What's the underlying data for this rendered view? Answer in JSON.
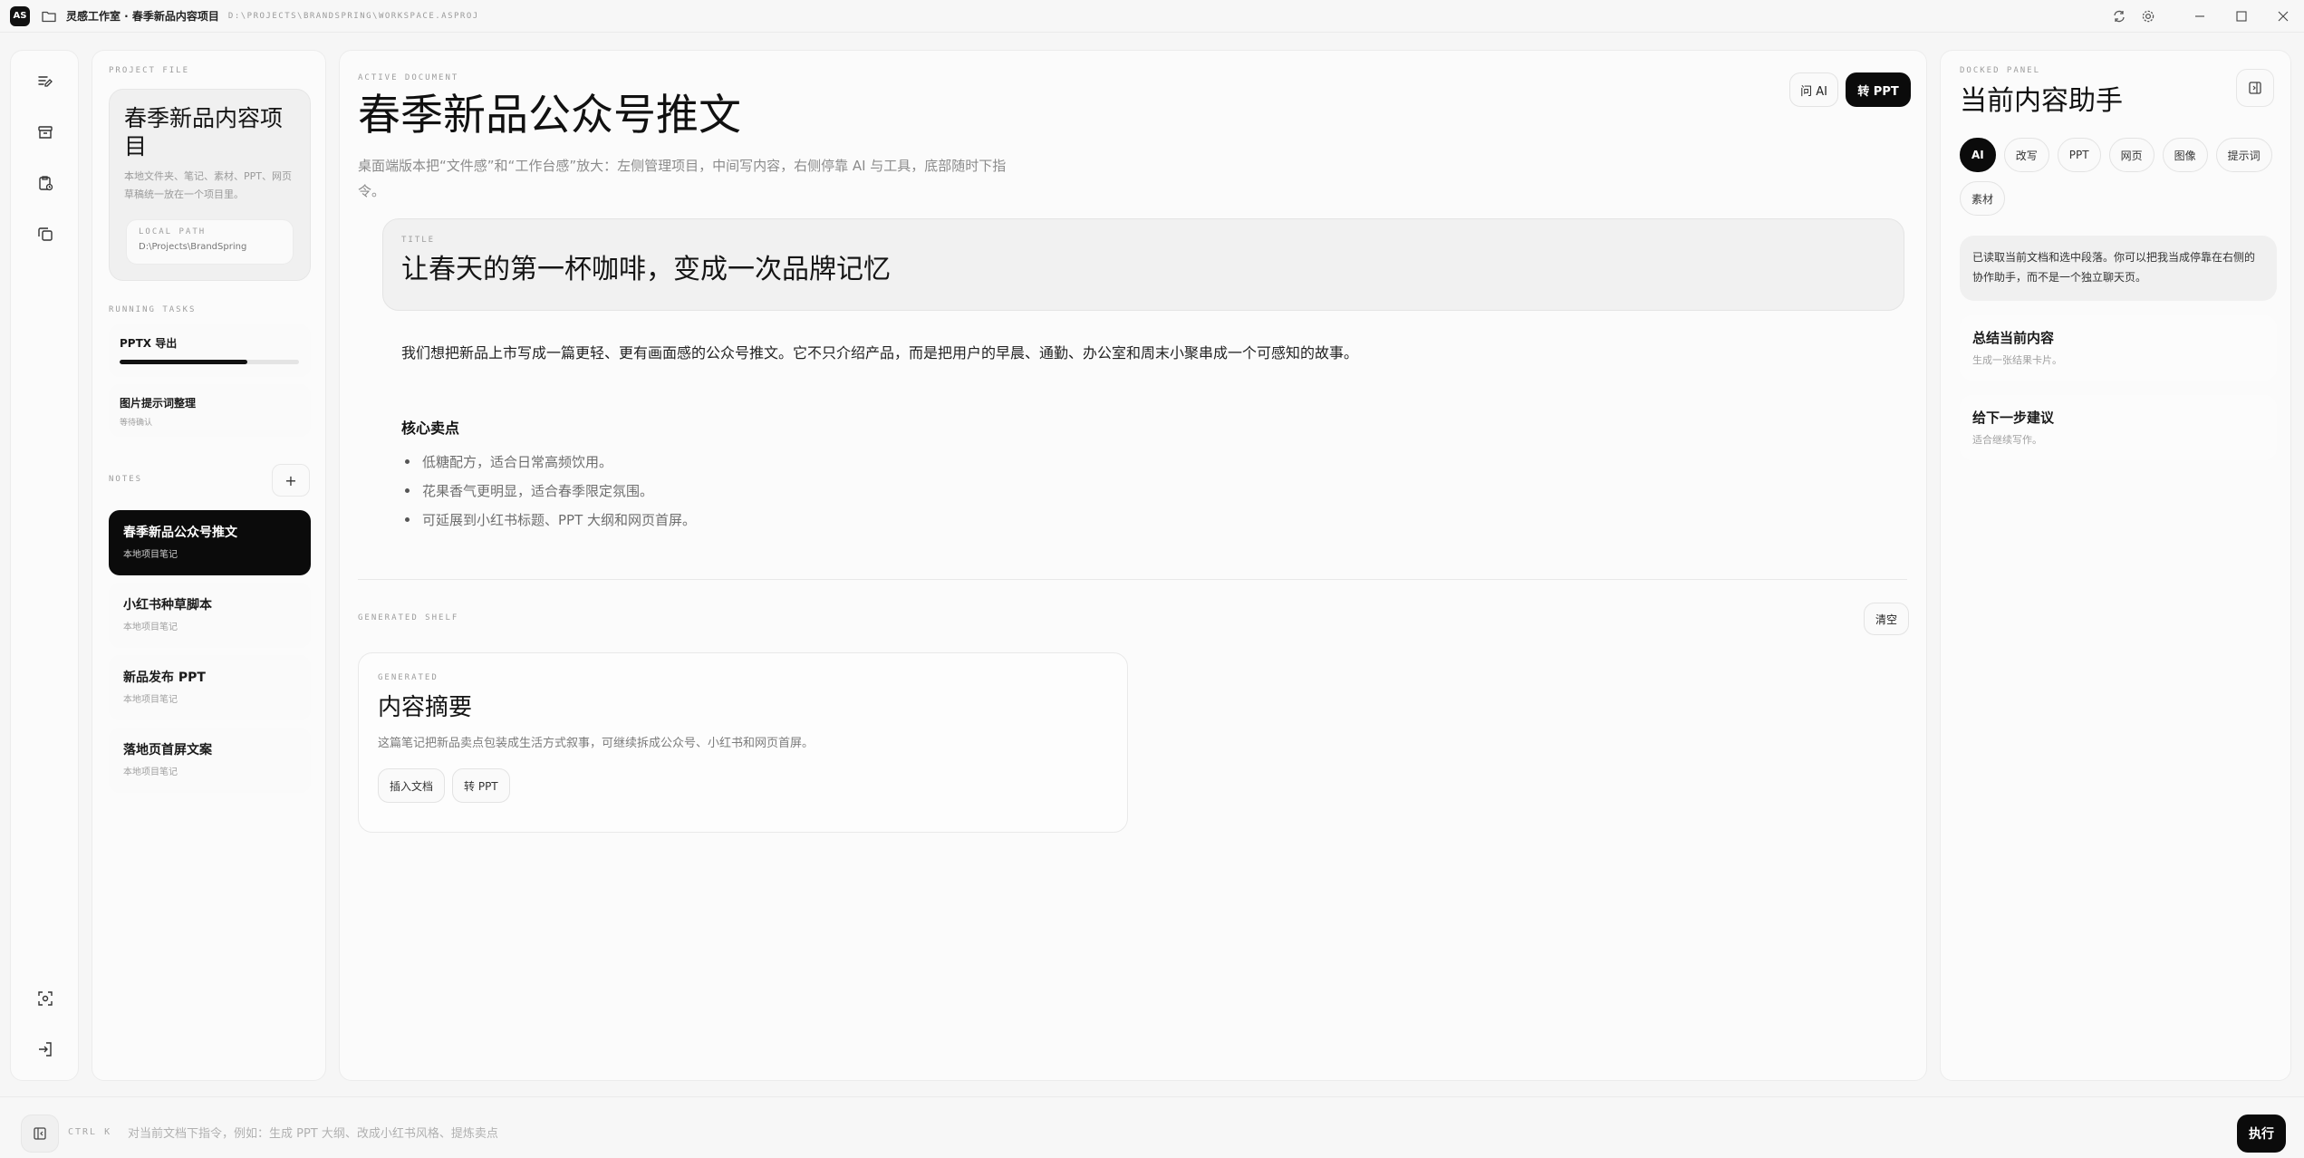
{
  "titlebar": {
    "logo": "AS",
    "title": "灵感工作室 · 春季新品内容项目",
    "path": "D:\\PROJECTS\\BRANDSPRING\\WORKSPACE.ASPROJ",
    "icons": [
      "sync-icon",
      "settings-icon",
      "minimize-icon",
      "maximize-icon",
      "close-icon"
    ]
  },
  "rail": {
    "top_icons": [
      "editor-icon",
      "archive-icon",
      "task-clipboard-icon",
      "copy-icon"
    ],
    "bottom_icons": [
      "capture-icon",
      "exit-icon"
    ]
  },
  "project": {
    "label": "PROJECT FILE",
    "name": "春季新品内容项目",
    "description": "本地文件夹、笔记、素材、PPT、网页草稿统一放在一个项目里。",
    "path_label": "LOCAL PATH",
    "path_value": "D:\\Projects\\BrandSpring",
    "tasks_label": "RUNNING TASKS",
    "tasks": [
      {
        "name": "PPTX 导出",
        "progress": 0.71
      },
      {
        "name": "图片提示词整理",
        "status": "等待确认"
      }
    ],
    "notes_label": "NOTES",
    "add_note": "+",
    "notes": [
      {
        "title": "春季新品公众号推文",
        "sub": "本地项目笔记",
        "active": true
      },
      {
        "title": "小红书种草脚本",
        "sub": "本地项目笔记"
      },
      {
        "title": "新品发布 PPT",
        "sub": "本地项目笔记"
      },
      {
        "title": "落地页首屏文案",
        "sub": "本地项目笔记"
      }
    ]
  },
  "document": {
    "label": "ACTIVE DOCUMENT",
    "title": "春季新品公众号推文",
    "description": "桌面端版本把“文件感”和“工作台感”放大：左侧管理项目，中间写内容，右侧停靠 AI 与工具，底部随时下指令。",
    "ask_ai": "问 AI",
    "to_ppt": "转 PPT",
    "title_label": "TITLE",
    "title_value": "让春天的第一杯咖啡，变成一次品牌记忆",
    "paragraph": "我们想把新品上市写成一篇更轻、更有画面感的公众号推文。它不只介绍产品，而是把用户的早晨、通勤、办公室和周末小聚串成一个可感知的故事。",
    "core_heading": "核心卖点",
    "bullets": [
      "低糖配方，适合日常高频饮用。",
      "花果香气更明显，适合春季限定氛围。",
      "可延展到小红书标题、PPT 大纲和网页首屏。"
    ],
    "shelf_label": "GENERATED SHELF",
    "clear": "清空",
    "generated": {
      "label": "GENERATED",
      "title": "内容摘要",
      "description": "这篇笔记把新品卖点包装成生活方式叙事，可继续拆成公众号、小红书和网页首屏。",
      "insert": "插入文档",
      "to_ppt": "转 PPT"
    }
  },
  "dock": {
    "label": "DOCKED PANEL",
    "title": "当前内容助手",
    "tabs": [
      "AI",
      "改写",
      "PPT",
      "网页",
      "图像",
      "提示词",
      "素材"
    ],
    "active_tab": "AI",
    "message": "已读取当前文档和选中段落。你可以把我当成停靠在右侧的协作助手，而不是一个独立聊天页。",
    "actions": [
      {
        "title": "总结当前内容",
        "sub": "生成一张结果卡片。"
      },
      {
        "title": "给下一步建议",
        "sub": "适合继续写作。"
      }
    ]
  },
  "command": {
    "shortcut": "CTRL K",
    "placeholder": "对当前文档下指令，例如：生成 PPT 大纲、改成小红书风格、提炼卖点",
    "run": "执行"
  },
  "colors": {
    "accent": "#0b0b0b",
    "background": "#f6f6f6",
    "panel": "#fbfbfb"
  }
}
